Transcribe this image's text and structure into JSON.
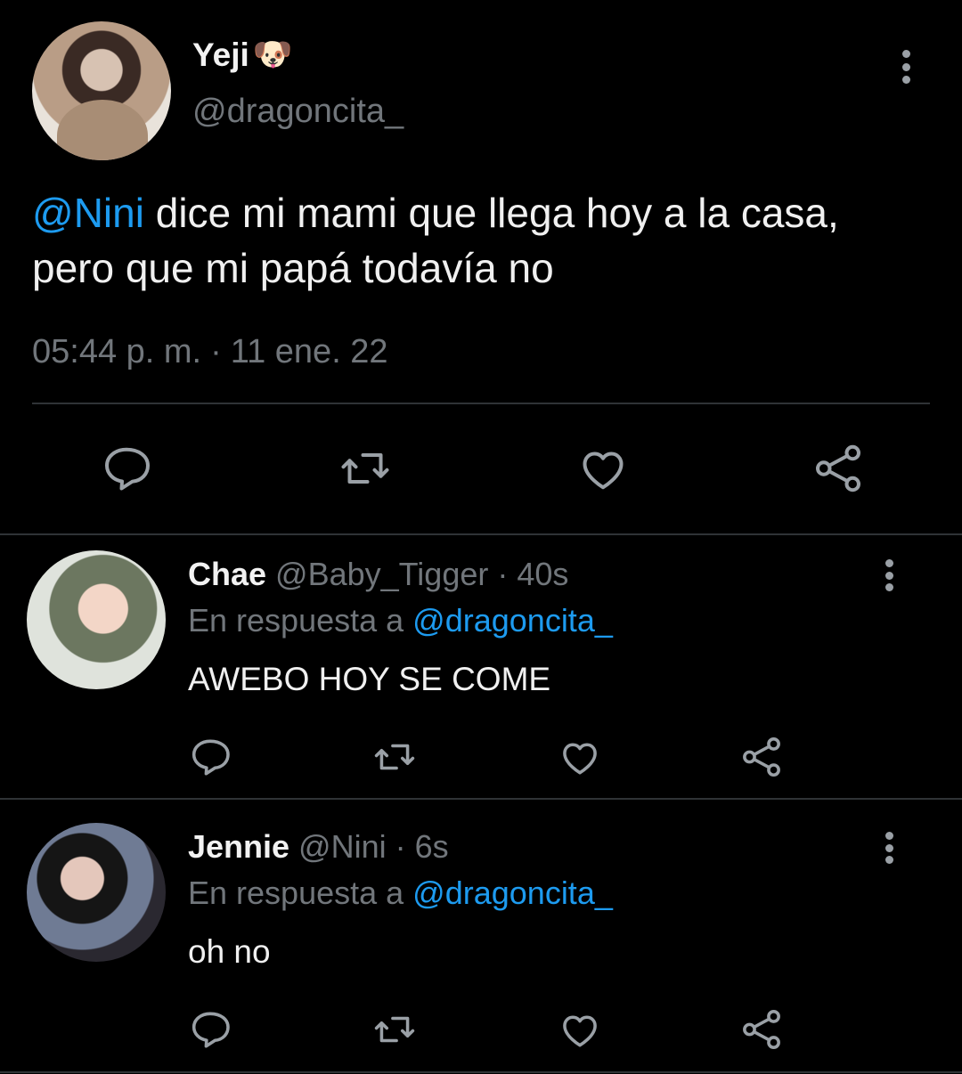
{
  "main_tweet": {
    "display_name": "Yeji",
    "name_emoji": "🐶",
    "handle": "@dragoncita_",
    "mention": "@Nini",
    "text": " dice mi mami que llega hoy a la casa, pero que mi papá todavía no",
    "time": "05:44 p. m.",
    "separator": "·",
    "date": "11 ene. 22"
  },
  "replies": [
    {
      "display_name": "Chae",
      "handle": "@Baby_Tigger",
      "separator": "·",
      "age": "40s",
      "reply_prefix": "En respuesta a ",
      "reply_to": "@dragoncita_",
      "text": "AWEBO HOY SE COME"
    },
    {
      "display_name": "Jennie",
      "handle": "@Nini",
      "separator": "·",
      "age": "6s",
      "reply_prefix": "En respuesta a ",
      "reply_to": "@dragoncita_",
      "text": "oh no"
    }
  ],
  "icons": {
    "reply": "reply-icon",
    "retweet": "retweet-icon",
    "like": "heart-icon",
    "share": "share-icon",
    "more": "more-options-icon"
  },
  "colors": {
    "background": "#000000",
    "accent": "#1d9bf0",
    "muted": "#71767b",
    "divider": "#2f3336"
  }
}
